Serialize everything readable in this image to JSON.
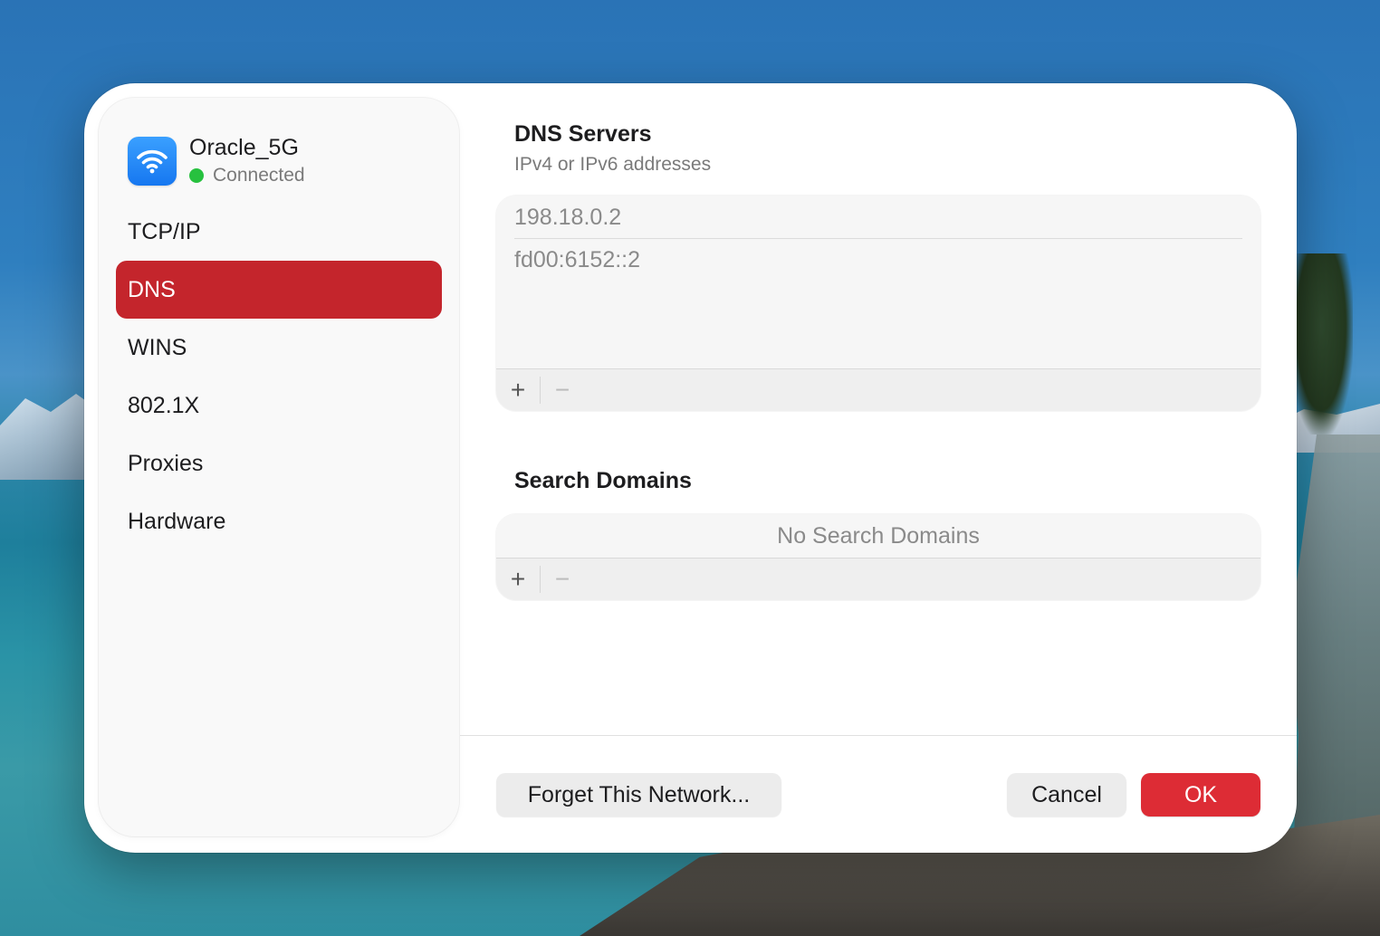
{
  "network": {
    "name": "Oracle_5G",
    "status": "Connected",
    "icon": "wifi-icon",
    "status_color": "#27c13f"
  },
  "sidebar": {
    "items": [
      {
        "label": "TCP/IP",
        "active": false
      },
      {
        "label": "DNS",
        "active": true
      },
      {
        "label": "WINS",
        "active": false
      },
      {
        "label": "802.1X",
        "active": false
      },
      {
        "label": "Proxies",
        "active": false
      },
      {
        "label": "Hardware",
        "active": false
      }
    ],
    "active_color": "#c4252c"
  },
  "dns": {
    "title": "DNS Servers",
    "subtitle": "IPv4 or IPv6 addresses",
    "servers": [
      "198.18.0.2",
      "fd00:6152::2"
    ],
    "add_label": "+",
    "remove_label": "−"
  },
  "search_domains": {
    "title": "Search Domains",
    "empty_label": "No Search Domains",
    "add_label": "+",
    "remove_label": "−"
  },
  "footer": {
    "forget_label": "Forget This Network...",
    "cancel_label": "Cancel",
    "ok_label": "OK",
    "ok_color": "#dd2c35"
  }
}
